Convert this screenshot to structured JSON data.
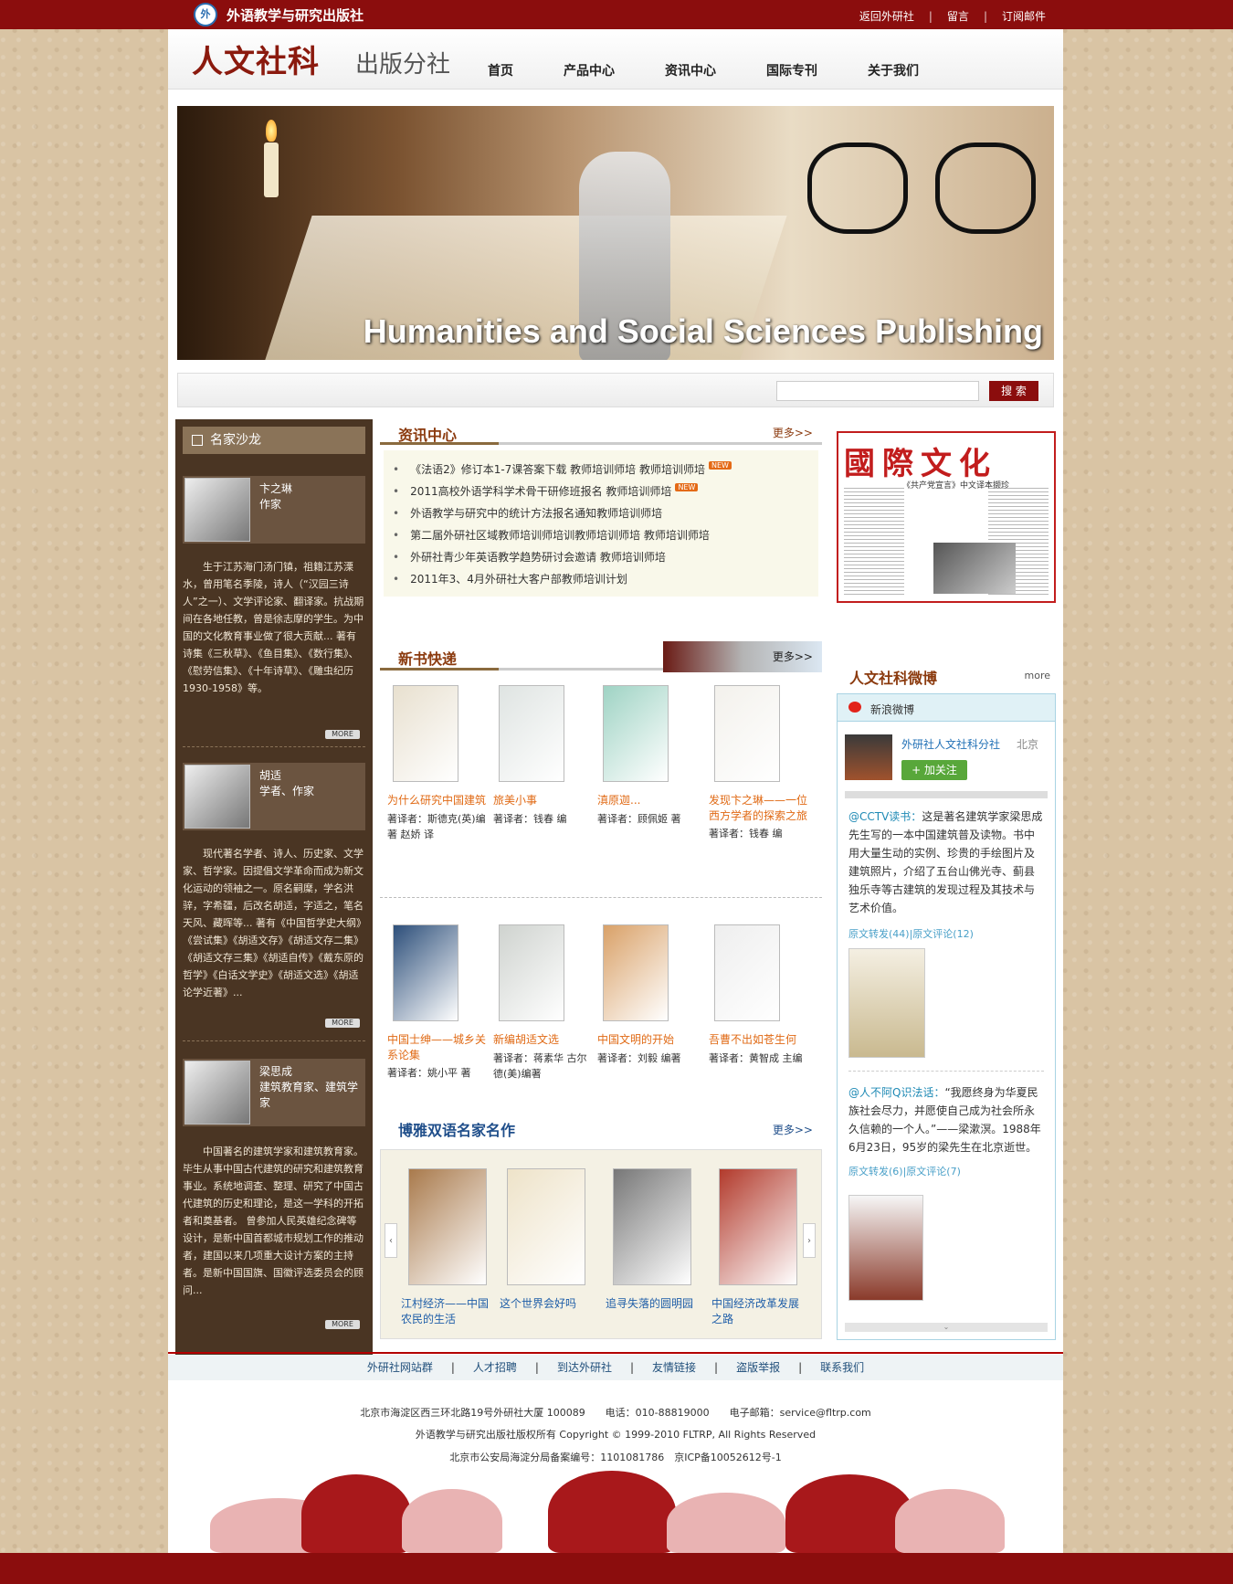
{
  "topbar": {
    "logo_glyph": "外",
    "brand": "外语教学与研究出版社",
    "links": [
      "返回外研社",
      "留言",
      "订阅邮件"
    ]
  },
  "header": {
    "title": "人文社科",
    "subtitle": "出版分社",
    "nav": [
      "首页",
      "产品中心",
      "资讯中心",
      "国际专刊",
      "关于我们"
    ]
  },
  "banner": {
    "text": "Humanities and Social Sciences Publishing"
  },
  "search": {
    "value": "",
    "button": "搜 索"
  },
  "left": {
    "title": "名家沙龙",
    "more": "MORE",
    "scholars": [
      {
        "name": "卞之琳",
        "role": "作家",
        "desc": "生于江苏海门汤门镇，祖籍江苏溧水，曾用笔名季陵，诗人（“汉园三诗人”之一）、文学评论家、翻译家。抗战期间在各地任教，曾是徐志摩的学生。为中国的文化教育事业做了很大贡献... 著有诗集《三秋草》、《鱼目集》、《数行集》、《慰劳信集》、《十年诗草》、《雕虫纪历1930-1958》等。"
      },
      {
        "name": "胡适",
        "role": "学者、作家",
        "desc": "现代著名学者、诗人、历史家、文学家、哲学家。因提倡文学革命而成为新文化运动的领袖之一。原名嗣穈，学名洪骍，字希疆，后改名胡适，字适之，笔名天风、藏晖等... 著有《中国哲学史大纲》《尝试集》《胡适文存》《胡适文存二集》《胡适文存三集》《胡适自传》《戴东原的哲学》《白话文学史》《胡适文选》《胡适论学近著》..."
      },
      {
        "name": "梁思成",
        "role": "建筑教育家、建筑学家",
        "desc": "中国著名的建筑学家和建筑教育家。毕生从事中国古代建筑的研究和建筑教育事业。系统地调查、整理、研究了中国古代建筑的历史和理论，是这一学科的开拓者和奠基者。 曾参加人民英雄纪念碑等设计，是新中国首都城市规划工作的推动者，建国以来几项重大设计方案的主持者。是新中国国旗、国徽评选委员会的顾问..."
      }
    ]
  },
  "news": {
    "title": "资讯中心",
    "more": "更多>>",
    "new_badge": "NEW",
    "items": [
      {
        "text": "《法语2》修订本1-7课答案下载 教师培训师培 教师培训师培",
        "is_new": true
      },
      {
        "text": "2011高校外语学科学术骨干研修班报名 教师培训师培",
        "is_new": true
      },
      {
        "text": "外语教学与研究中的统计方法报名通知教师培训师培",
        "is_new": false
      },
      {
        "text": "第二届外研社区域教师培训师培训教师培训师培 教师培训师培",
        "is_new": false
      },
      {
        "text": "外研社青少年英语教学趋势研讨会邀请 教师培训师培",
        "is_new": false
      },
      {
        "text": "2011年3、4月外研社大客户部教师培训计划",
        "is_new": false
      }
    ]
  },
  "new_books": {
    "title": "新书快递",
    "more": "更多>>",
    "books": [
      {
        "title": "为什么研究中国建筑",
        "author": "著译者：斯德克(英)编著 赵娇 译",
        "color": "#e8e0cf"
      },
      {
        "title": "旅美小事",
        "author": "著译者：钱春 编",
        "color": "#dfe4e2"
      },
      {
        "title": "滇原迦...",
        "author": "著译者：顾佩姬 著",
        "color": "#9fd3c4"
      },
      {
        "title": "发现卞之琳——一位西方学者的探索之旅",
        "author": "著译者：钱春 编",
        "color": "#f3f1ec"
      },
      {
        "title": "中国士绅——城乡关系论集",
        "author": "著译者：姚小平 著",
        "color": "#2d4f7a"
      },
      {
        "title": "新编胡适文选",
        "author": "著译者：蒋素华 古尔德(美)编著",
        "color": "#cfd3cf"
      },
      {
        "title": "中国文明的开始",
        "author": "著译者：刘毅 编著",
        "color": "#d9a168"
      },
      {
        "title": "吾曹不出如苍生何",
        "author": "著译者：黄智成 主编",
        "color": "#eeeeee"
      }
    ]
  },
  "bilingual": {
    "title": "博雅双语名家名作",
    "more": "更多>>",
    "prev": "‹",
    "next": "›",
    "books": [
      {
        "title": "江村经济——中国农民的生活",
        "color": "#a97a4c"
      },
      {
        "title": "这个世界会好吗",
        "color": "#eee3c9"
      },
      {
        "title": "追寻失落的圆明园",
        "color": "#777777"
      },
      {
        "title": "中国经济改革发展之路",
        "color": "#b23a2c"
      }
    ]
  },
  "magazine": {
    "title": "國際文化",
    "subtitle": "《共产党宣言》中文译本撷珍"
  },
  "weibo": {
    "title": "人文社科微博",
    "more": "more",
    "platform": "新浪微博",
    "account": "外研社人文社科分社",
    "location": "北京",
    "follow": "+ 加关注",
    "scroll": "⌄",
    "posts": [
      {
        "at": "@CCTV读书：",
        "text": "这是著名建筑学家梁思成先生写的一本中国建筑普及读物。书中用大量生动的实例、珍贵的手绘图片及建筑照片，介绍了五台山佛光寺、蓟县独乐寺等古建筑的发现过程及其技术与艺术价值。",
        "links": "原文转发(44)|原文评论(12)"
      },
      {
        "at": "@人不阿Q识法话：",
        "text": "“我愿终身为华夏民族社会尽力，并愿使自己成为社会所永久信赖的一个人。”——梁漱溟。1988年6月23日，95岁的梁先生在北京逝世。",
        "links": "原文转发(6)|原文评论(7)"
      }
    ]
  },
  "footer": {
    "links": [
      "外研社网站群",
      "人才招聘",
      "到达外研社",
      "友情链接",
      "盗版举报",
      "联系我们"
    ],
    "address": "北京市海淀区西三环北路19号外研社大厦 100089　　电话：010-88819000　　电子邮箱：service@fltrp.com",
    "copyright": "外语教学与研究出版社版权所有 Copyright © 1999-2010 FLTRP, All Rights Reserved",
    "icp": "北京市公安局海淀分局备案编号：1101081786　京ICP备10052612号-1"
  }
}
